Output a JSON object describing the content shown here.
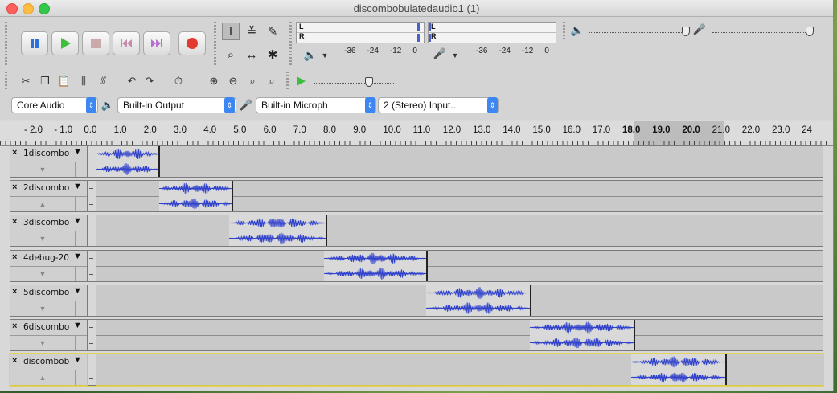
{
  "window": {
    "title": "discombobulatedaudio1 (1)"
  },
  "transport": {
    "pause": "pause-button",
    "play": "play-button",
    "stop": "stop-button",
    "skip_start": "skip-to-start-button",
    "skip_end": "skip-to-end-button",
    "record": "record-button"
  },
  "tools": {
    "selection": "I",
    "envelope": "≚",
    "draw": "✎",
    "zoom": "⌕",
    "timeshift": "↔",
    "multi": "✱"
  },
  "meters": {
    "record_L": "L",
    "record_R": "R",
    "play_L": "L",
    "play_R": "R",
    "scale": [
      "-36",
      "-24",
      "-12",
      "0"
    ]
  },
  "devices": {
    "host": "Core Audio",
    "output": "Built-in Output",
    "input": "Built-in Microph",
    "channels": "2 (Stereo) Input..."
  },
  "ruler": {
    "labels": [
      "- 2.0",
      "- 1.0",
      "0.0",
      "1.0",
      "2.0",
      "3.0",
      "4.0",
      "5.0",
      "6.0",
      "7.0",
      "8.0",
      "9.0",
      "10.0",
      "11.0",
      "12.0",
      "13.0",
      "14.0",
      "15.0",
      "16.0",
      "17.0",
      "18.0",
      "19.0",
      "20.0",
      "21.0",
      "22.0",
      "23.0",
      "24"
    ]
  },
  "tracks": [
    {
      "name": "1discombo",
      "collapse": "▼"
    },
    {
      "name": "2discombo",
      "collapse": "▲"
    },
    {
      "name": "3discombo",
      "collapse": "▼"
    },
    {
      "name": "4debug-20",
      "collapse": "▼"
    },
    {
      "name": "5discombo",
      "collapse": "▼"
    },
    {
      "name": "6discombo",
      "collapse": "▼"
    },
    {
      "name": "discombob",
      "collapse": "▲"
    }
  ],
  "track_close": "×",
  "track_menu": "▼",
  "colors": {
    "accent": "#3d87f5",
    "waveform": "#3344cc",
    "record": "#e23a2e",
    "play": "#3dbf3d"
  }
}
